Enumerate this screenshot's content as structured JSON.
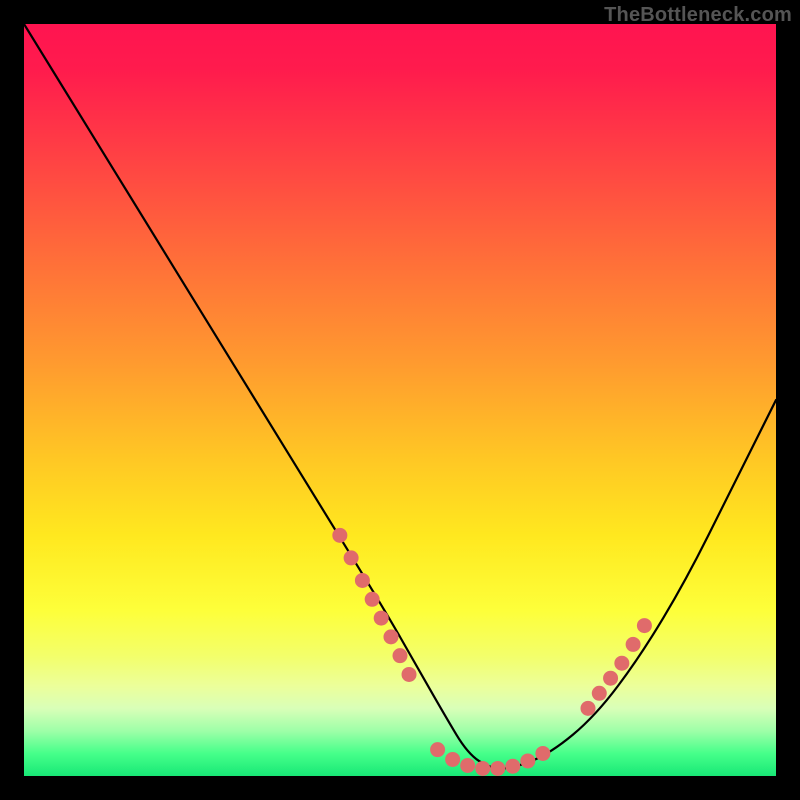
{
  "watermark": "TheBottleneck.com",
  "chart_data": {
    "type": "line",
    "title": "",
    "xlabel": "",
    "ylabel": "",
    "xlim": [
      0,
      100
    ],
    "ylim": [
      0,
      100
    ],
    "series": [
      {
        "name": "bottleneck-curve",
        "x": [
          0,
          8,
          16,
          24,
          32,
          40,
          48,
          52,
          56,
          59,
          62,
          65,
          70,
          76,
          82,
          88,
          94,
          100
        ],
        "y": [
          100,
          87,
          74,
          61,
          48,
          35,
          22,
          15,
          8,
          3,
          1,
          1,
          3,
          8,
          16,
          26,
          38,
          50
        ]
      }
    ],
    "highlight_points_left": {
      "name": "left-cluster",
      "color": "#e06b6b",
      "x": [
        42,
        43.5,
        45,
        46.3,
        47.5,
        48.8,
        50,
        51.2
      ],
      "y": [
        32,
        29,
        26,
        23.5,
        21,
        18.5,
        16,
        13.5
      ]
    },
    "highlight_points_bottom": {
      "name": "bottom-cluster",
      "color": "#e06b6b",
      "x": [
        55,
        57,
        59,
        61,
        63,
        65,
        67,
        69
      ],
      "y": [
        3.5,
        2.2,
        1.4,
        1.0,
        1.0,
        1.3,
        2.0,
        3.0
      ]
    },
    "highlight_points_right": {
      "name": "right-cluster",
      "color": "#e06b6b",
      "x": [
        75,
        76.5,
        78,
        79.5,
        81,
        82.5
      ],
      "y": [
        9,
        11,
        13,
        15,
        17.5,
        20
      ]
    }
  }
}
